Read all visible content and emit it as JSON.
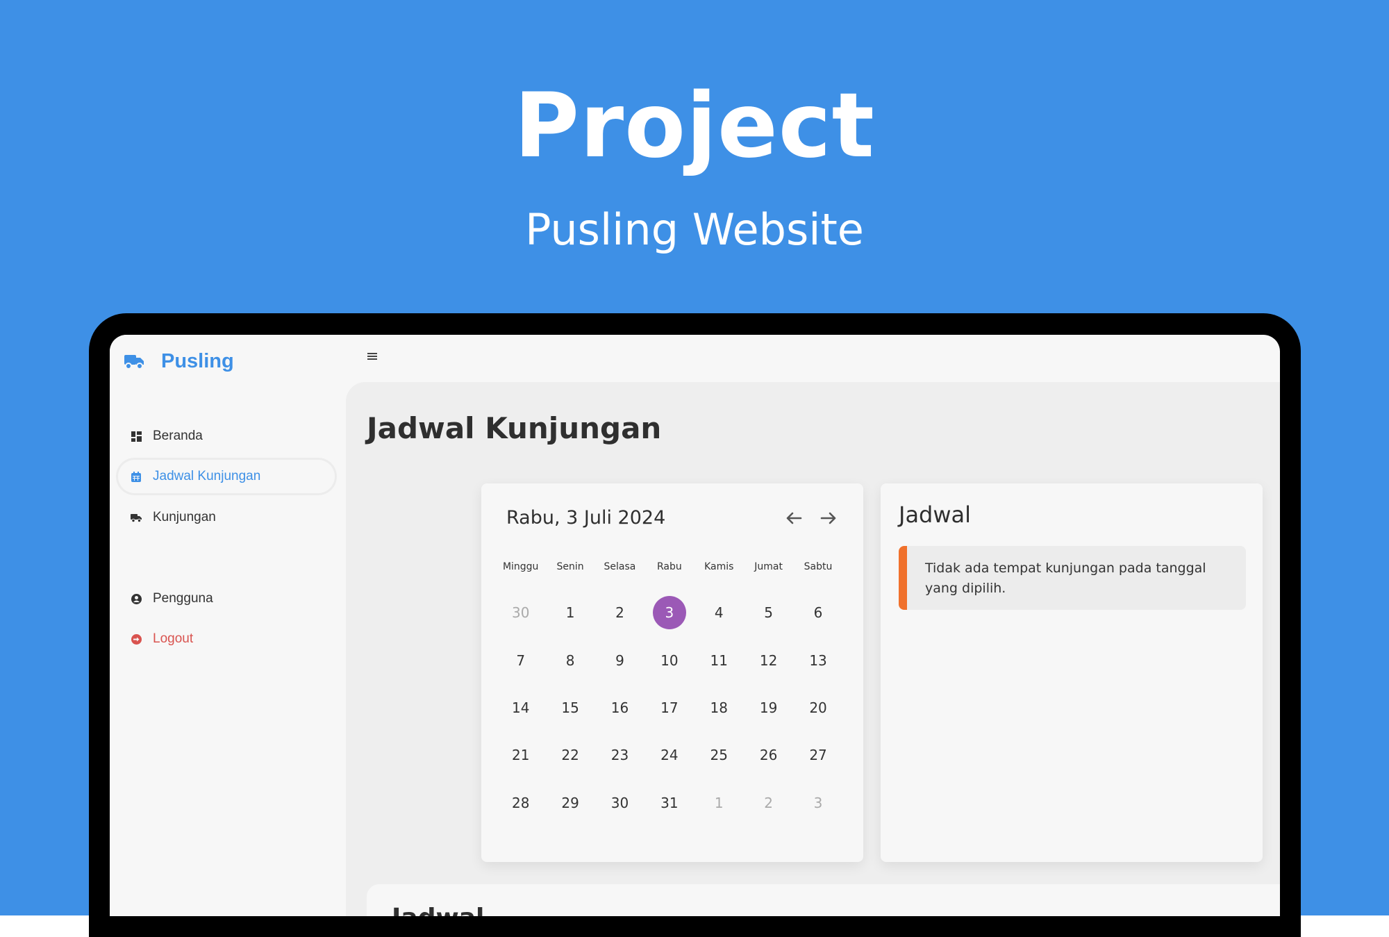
{
  "hero": {
    "title": "Project",
    "subtitle": "Pusling Website",
    "background_color": "#3e90e6"
  },
  "sidebar": {
    "brand": {
      "label": "Pusling",
      "icon": "truck-icon",
      "color": "#3e90e6"
    },
    "items": [
      {
        "label": "Beranda",
        "icon": "dashboard-icon"
      },
      {
        "label": "Jadwal Kunjungan",
        "icon": "calendar-icon",
        "active": true
      },
      {
        "label": "Kunjungan",
        "icon": "truck-icon"
      },
      {
        "label": "Pengguna",
        "icon": "user-circle-icon"
      },
      {
        "label": "Logout",
        "icon": "logout-icon",
        "color": "#d9534f"
      }
    ]
  },
  "topbar": {
    "menu_icon": "hamburger-icon"
  },
  "main": {
    "page_title": "Jadwal Kunjungan",
    "calendar": {
      "current_date": "Rabu, 3 Juli 2024",
      "prev_icon": "arrow-left-icon",
      "next_icon": "arrow-right-icon",
      "weekdays": [
        "Minggu",
        "Senin",
        "Selasa",
        "Rabu",
        "Kamis",
        "Jumat",
        "Sabtu"
      ],
      "weeks": [
        [
          "30",
          "1",
          "2",
          "3",
          "4",
          "5",
          "6"
        ],
        [
          "7",
          "8",
          "9",
          "10",
          "11",
          "12",
          "13"
        ],
        [
          "14",
          "15",
          "16",
          "17",
          "18",
          "19",
          "20"
        ],
        [
          "21",
          "22",
          "23",
          "24",
          "25",
          "26",
          "27"
        ],
        [
          "28",
          "29",
          "30",
          "31",
          "1",
          "2",
          "3"
        ]
      ],
      "selected_day": "3",
      "selected_color": "#9b59b6"
    },
    "schedule": {
      "title": "Jadwal",
      "empty_message": "Tidak ada tempat kunjungan pada tanggal yang dipilih.",
      "alert_color": "#f0712c"
    },
    "bottom_section_title": "Jadwal"
  }
}
